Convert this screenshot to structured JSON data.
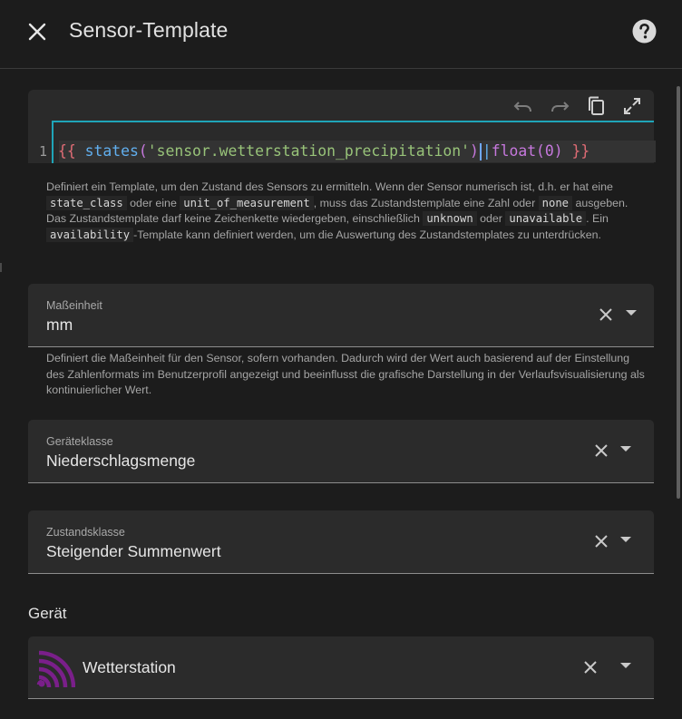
{
  "dialog": {
    "title": "Sensor-Template"
  },
  "editor": {
    "line_number": "1",
    "code": {
      "open": "{{",
      "fn": "states",
      "lparen": "(",
      "arg": "'sensor.wetterstation_precipitation'",
      "rparen": ")",
      "pipe": "|",
      "filter": "float(0)",
      "close": "}}"
    },
    "toolbar_icons": [
      "undo-icon",
      "redo-icon",
      "copy-icon",
      "fullscreen-icon"
    ]
  },
  "template_help": {
    "t1": "Definiert ein Template, um den Zustand des Sensors zu ermitteln. Wenn der Sensor numerisch ist, d.h. er hat eine ",
    "c1": "state_class",
    "t2": " oder eine ",
    "c2": "unit_of_measurement",
    "t3": ", muss das Zustandstemplate eine Zahl oder ",
    "c3": "none",
    "t4": " ausgeben. Das Zustandstemplate darf keine Zeichenkette wiedergeben, einschließlich ",
    "c4": "unknown",
    "t5": " oder ",
    "c5": "unavailable",
    "t6": ". Ein ",
    "c6": "availability",
    "t7": "-Template kann definiert werden, um die Auswertung des Zustandstemplates zu unterdrücken."
  },
  "unit": {
    "label": "Maßeinheit",
    "value": "mm",
    "help": "Definiert die Maßeinheit für den Sensor, sofern vorhanden. Dadurch wird der Wert auch basierend auf der Einstellung des Zahlenformats im Benutzerprofil angezeigt und beeinflusst die grafische Darstellung in der Verlaufsvisualisierung als kontinuierlicher Wert."
  },
  "device_class": {
    "label": "Geräteklasse",
    "value": "Niederschlagsmenge"
  },
  "state_class": {
    "label": "Zustandsklasse",
    "value": "Steigender Summenwert"
  },
  "device_section": {
    "title": "Gerät",
    "device_name": "Wetterstation",
    "icon": "wifi-broadcast-icon",
    "icon_color": "#7a1f8a"
  },
  "colors": {
    "background": "#1c1c1c",
    "field": "#2b2b2b",
    "accent": "#1fa5b8"
  }
}
